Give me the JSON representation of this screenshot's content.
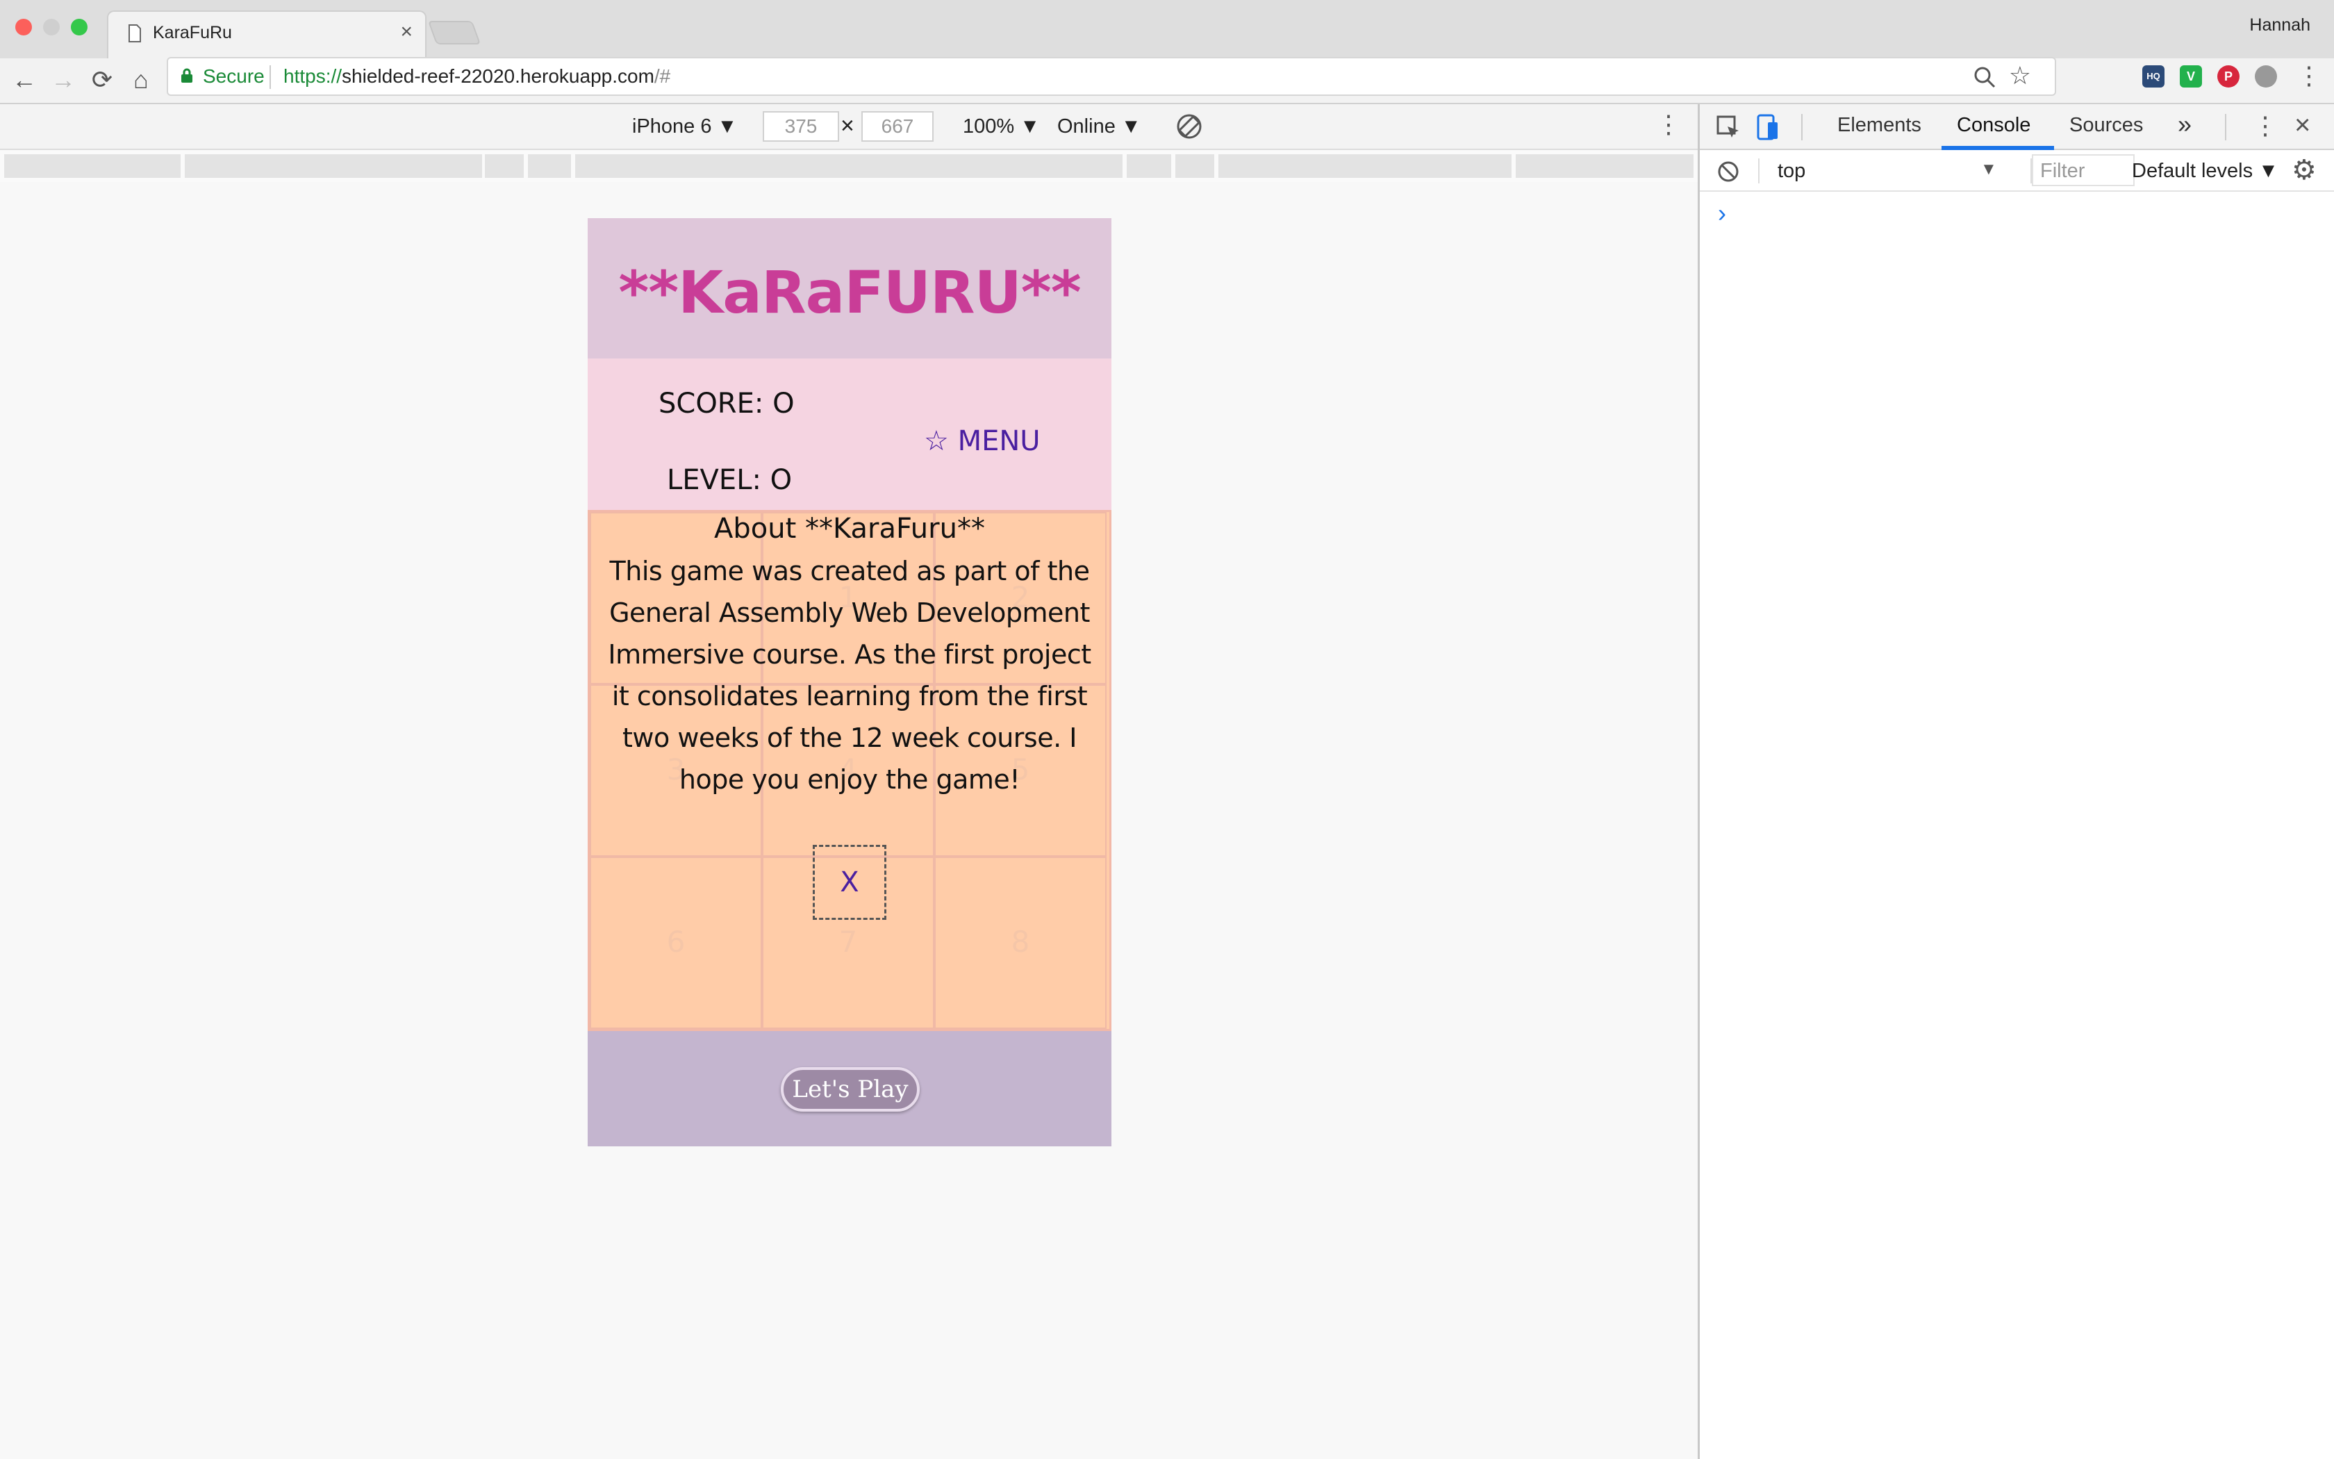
{
  "browser": {
    "tab_title": "KaraFuRu",
    "tab_close": "×",
    "user": "Hannah",
    "secure_label": "Secure",
    "url_scheme": "https://",
    "url_host": "shielded-reef-22020.herokuapp.com",
    "url_path": "/#",
    "back": "←",
    "forward": "→",
    "reload": "⟳",
    "home": "⌂"
  },
  "device_toolbar": {
    "device": "iPhone 6 ▼",
    "width": "375",
    "times": "×",
    "height": "667",
    "zoom": "100% ▼",
    "network": "Online ▼"
  },
  "game": {
    "logo": "**KaRaFURU**",
    "score": "SCORE: O",
    "level": "LEVEL: O",
    "menu": "☆ MENU",
    "cells": [
      "",
      "1",
      "2",
      "3",
      "4",
      "5",
      "6",
      "7",
      "8"
    ],
    "about_title": "About **KaraFuru**",
    "about_body": "This game was created as part of the General Assembly Web Development Immersive course. As the first project it consolidates learning from the first two weeks of the 12 week course. I hope you enjoy the game!",
    "close": "X",
    "play": "Let's Play"
  },
  "devtools": {
    "tabs": [
      "Elements",
      "Console",
      "Sources"
    ],
    "active_tab": "Console",
    "more": "»",
    "context": "top",
    "filter_placeholder": "Filter",
    "levels": "Default levels ▼",
    "prompt": "›"
  },
  "colors": {
    "accent": "#1a73e8",
    "logo": "#c93d97",
    "board": "#ffcca8"
  }
}
